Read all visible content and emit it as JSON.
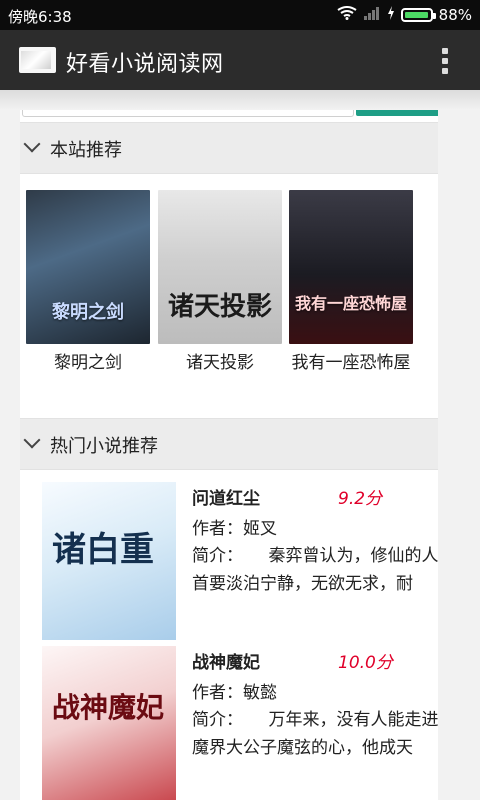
{
  "status": {
    "time": "傍晚6:38",
    "battery": "88%"
  },
  "app": {
    "title": "好看小说阅读网"
  },
  "sections": {
    "featured": "本站推荐",
    "hot": "热门小说推荐"
  },
  "featured_books": [
    {
      "title": "黎明之剑",
      "cover_text": "黎明之剑"
    },
    {
      "title": "诸天投影",
      "cover_text": "诸天投影"
    },
    {
      "title": "我有一座恐怖屋",
      "cover_text": "我有一座恐怖屋"
    }
  ],
  "hot_books": [
    {
      "title": "问道红尘",
      "score": "9.2分",
      "author": "作者：姬叉",
      "summary": "简介：　　秦弈曾认为，修仙的人首要淡泊宁静，无欲无求，耐",
      "cover_text": "诸白重"
    },
    {
      "title": "战神魔妃",
      "score": "10.0分",
      "author": "作者：敏懿",
      "summary": "简介：　　万年来，没有人能走进魔界大公子魔弦的心，他成天",
      "cover_text": "战神魔妃"
    }
  ],
  "colors": {
    "accent": "#1e9e86",
    "score": "#e0002a",
    "battery": "#4cd964"
  }
}
